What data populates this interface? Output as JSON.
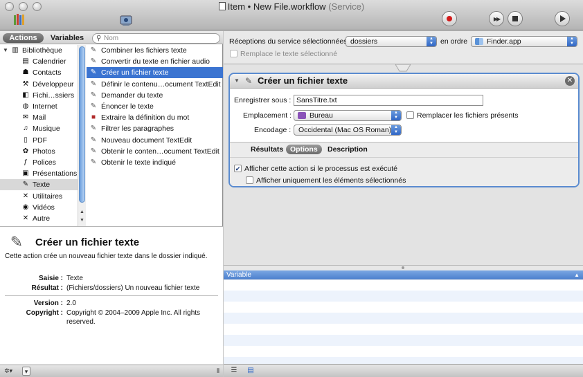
{
  "window": {
    "title": "Item • New File.workflow",
    "title_suffix": "(Service)"
  },
  "toolbar": {
    "record_icon": "record-icon",
    "step_icon": "step-icon",
    "stop_icon": "stop-icon",
    "run_icon": "run-icon",
    "library_icon": "library-icon",
    "media_icon": "media-icon"
  },
  "left": {
    "tabs": {
      "actions": "Actions",
      "variables": "Variables"
    },
    "search": {
      "placeholder": "Nom"
    },
    "library": [
      {
        "label": "Bibliothèque",
        "icon": "library-icon",
        "glyph": "▥",
        "root": true
      },
      {
        "label": "Calendrier",
        "icon": "calendar-icon",
        "glyph": "▤"
      },
      {
        "label": "Contacts",
        "icon": "contacts-icon",
        "glyph": "☗"
      },
      {
        "label": "Développeur",
        "icon": "developer-icon",
        "glyph": "⚒"
      },
      {
        "label": "Fichi…ssiers",
        "icon": "finder-icon",
        "glyph": "◧"
      },
      {
        "label": "Internet",
        "icon": "internet-icon",
        "glyph": "◍"
      },
      {
        "label": "Mail",
        "icon": "mail-icon",
        "glyph": "✉"
      },
      {
        "label": "Musique",
        "icon": "music-icon",
        "glyph": "♫"
      },
      {
        "label": "PDF",
        "icon": "pdf-icon",
        "glyph": "▯"
      },
      {
        "label": "Photos",
        "icon": "photos-icon",
        "glyph": "✿"
      },
      {
        "label": "Polices",
        "icon": "fonts-icon",
        "glyph": "ƒ"
      },
      {
        "label": "Présentations",
        "icon": "presentations-icon",
        "glyph": "▣"
      },
      {
        "label": "Texte",
        "icon": "text-icon",
        "glyph": "✎",
        "selected": true
      },
      {
        "label": "Utilitaires",
        "icon": "utilities-icon",
        "glyph": "✕"
      },
      {
        "label": "Vidéos",
        "icon": "videos-icon",
        "glyph": "◉"
      },
      {
        "label": "Autre",
        "icon": "other-icon",
        "glyph": "✕"
      }
    ],
    "actions": [
      {
        "label": "Combiner les fichiers texte",
        "icon": "text-action-icon",
        "glyph": "✎"
      },
      {
        "label": "Convertir du texte en fichier audio",
        "icon": "text-action-icon",
        "glyph": "✎"
      },
      {
        "label": "Créer un fichier texte",
        "icon": "text-action-icon",
        "glyph": "✎",
        "selected": true
      },
      {
        "label": "Définir le contenu…ocument TextEdit",
        "icon": "text-action-icon",
        "glyph": "✎"
      },
      {
        "label": "Demander du texte",
        "icon": "text-action-icon",
        "glyph": "✎"
      },
      {
        "label": "Énoncer le texte",
        "icon": "text-action-icon",
        "glyph": "✎"
      },
      {
        "label": "Extraire la définition du mot",
        "icon": "dictionary-icon",
        "glyph": "■"
      },
      {
        "label": "Filtrer les paragraphes",
        "icon": "text-action-icon",
        "glyph": "✎"
      },
      {
        "label": "Nouveau document TextEdit",
        "icon": "text-action-icon",
        "glyph": "✎"
      },
      {
        "label": "Obtenir le conten…ocument TextEdit",
        "icon": "text-action-icon",
        "glyph": "✎"
      },
      {
        "label": "Obtenir le texte indiqué",
        "icon": "text-action-icon",
        "glyph": "✎"
      }
    ],
    "description": {
      "title": "Créer un fichier texte",
      "text": "Cette action crée un nouveau fichier texte dans le dossier indiqué.",
      "input_label": "Saisie :",
      "input_value": "Texte",
      "result_label": "Résultat :",
      "result_value": "(Fichiers/dossiers) Un nouveau fichier texte",
      "version_label": "Version :",
      "version_value": "2.0",
      "copyright_label": "Copyright :",
      "copyright_value": "Copyright © 2004–2009 Apple Inc.  All rights reserved."
    }
  },
  "service": {
    "receives_label": "Réceptions du service sélectionnées",
    "receives_value": "dossiers",
    "in_label": "en ordre",
    "app_value": "Finder.app",
    "replace_text_label": "Remplace le texte sélectionné",
    "replace_text_checked": false
  },
  "action_card": {
    "title": "Créer un fichier texte",
    "save_as_label": "Enregistrer sous :",
    "save_as_value": "SansTitre.txt",
    "location_label": "Emplacement :",
    "location_value": "Bureau",
    "replace_label": "Remplacer les fichiers présents",
    "replace_checked": false,
    "encoding_label": "Encodage :",
    "encoding_value": "Occidental (Mac OS Roman)",
    "tabs": {
      "results": "Résultats",
      "options": "Options",
      "description": "Description"
    },
    "show_action_label": "Afficher cette action si le processus est exécuté",
    "show_action_checked": true,
    "show_selected_label": "Afficher uniquement les éléments sélectionnés",
    "show_selected_checked": false
  },
  "variables": {
    "column_header": "Variable"
  },
  "colors": {
    "selection": "#3b74d1",
    "card_border": "#5a8bd0",
    "record": "#d31a1a"
  }
}
